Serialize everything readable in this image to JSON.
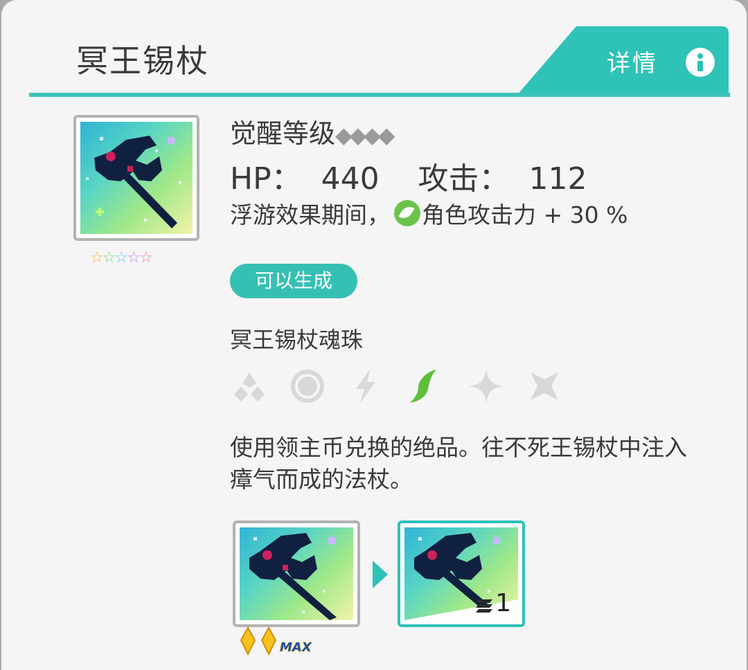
{
  "header": {
    "title": "冥王锡杖",
    "detail_label": "详情",
    "info_icon": "info-icon"
  },
  "item": {
    "rarity_stars": 5,
    "awaken_label": "觉醒等级",
    "awaken_diamonds": 4,
    "stats_line": "HP：  440    攻击：  112",
    "effect_prefix": "浮游效果期间，",
    "effect_icon": "leaf-icon",
    "effect_text": "角色攻击力 + 30 %",
    "craft_badge": "可以生成",
    "orb_name": "冥王锡杖魂珠",
    "elements": [
      {
        "icon": "fire-icon",
        "active": false
      },
      {
        "icon": "water-orb-icon",
        "active": false
      },
      {
        "icon": "thunder-icon",
        "active": false
      },
      {
        "icon": "wind-leaf-icon",
        "active": true
      },
      {
        "icon": "light-star-icon",
        "active": false
      },
      {
        "icon": "dark-cross-icon",
        "active": false
      }
    ],
    "description": "使用领主币兑换的绝品。往不死王锡杖中注入瘴气而成的法杖。",
    "source_weapon": {
      "max_label": "MAX"
    },
    "target_item": {
      "quantity": "1"
    }
  },
  "colors": {
    "accent": "#2ec1b7",
    "active_element": "#5dbf3a",
    "inactive_element": "#d8d8d8",
    "text": "#3a3a3a"
  }
}
